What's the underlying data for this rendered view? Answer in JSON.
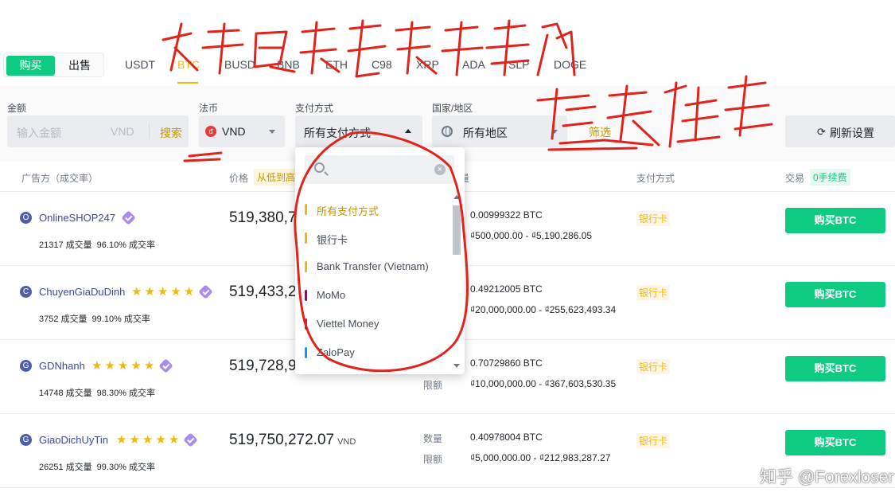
{
  "trade_toggle": {
    "buy": "购买",
    "sell": "出售"
  },
  "coins": [
    "USDT",
    "BTC",
    "BUSD",
    "BNB",
    "ETH",
    "C98",
    "XRP",
    "ADA",
    "SLP",
    "DOGE"
  ],
  "active_coin": "BTC",
  "filters": {
    "amount_label": "金额",
    "amount_placeholder": "输入金额",
    "amount_unit": "VND",
    "search_button": "搜索",
    "fiat_label": "法币",
    "fiat_value": "VND",
    "payment_label": "支付方式",
    "payment_value": "所有支付方式",
    "region_label": "国家/地区",
    "region_value": "所有地区",
    "filter_link": "筛选",
    "refresh_button": "刷新设置"
  },
  "table_header": {
    "advertiser": "广告方（成交率）",
    "price": "价格",
    "sort_badge": "从低到高",
    "quantity_tail": "量",
    "payment": "支付方式",
    "trade": "交易",
    "fee_badge": "0手续费"
  },
  "rows": [
    {
      "initial": "O",
      "merchant": "OnlineSHOP247",
      "stars": 0,
      "trades": "21317 成交量",
      "rate": "96.10% 成交率",
      "price": "519,380,7",
      "currency": "",
      "qty_label": "",
      "qty": "0.00999322 BTC",
      "limit_label": "",
      "limit": "₫500,000.00 - ₫5,190,286.05",
      "payment": "银行卡",
      "button": "购买BTC"
    },
    {
      "initial": "C",
      "merchant": "ChuyenGiaDuDinh",
      "stars": 5,
      "trades": "3752 成交量",
      "rate": "99.10% 成交率",
      "price": "519,433,2",
      "currency": "",
      "qty_label": "",
      "qty": "0.49212005 BTC",
      "limit_label": "",
      "limit": "₫20,000,000.00 - ₫255,623,493.34",
      "payment": "银行卡",
      "button": "购买BTC"
    },
    {
      "initial": "G",
      "merchant": "GDNhanh",
      "stars": 5,
      "trades": "14748 成交量",
      "rate": "98.30% 成交率",
      "price": "519,728,9",
      "currency": "",
      "qty_label": "",
      "qty": "0.70729860 BTC",
      "limit_label": "限额",
      "limit": "₫10,000,000.00 - ₫367,603,530.35",
      "payment": "银行卡",
      "button": "购买BTC"
    },
    {
      "initial": "G",
      "merchant": "GiaoDichUyTin",
      "stars": 5,
      "trades": "26251 成交量",
      "rate": "99.30% 成交率",
      "price": "519,750,272.07",
      "currency": "VND",
      "qty_label": "数量",
      "qty": "0.40978004 BTC",
      "limit_label": "限额",
      "limit": "₫5,000,000.00 - ₫212,983,287.27",
      "payment": "银行卡",
      "button": "购买BTC"
    }
  ],
  "dropdown": {
    "items": [
      {
        "label": "所有支付方式",
        "color": "#f0b90b",
        "selected": true
      },
      {
        "label": "银行卡",
        "color": "#f0b90b",
        "selected": false
      },
      {
        "label": "Bank Transfer (Vietnam)",
        "color": "#f0b90b",
        "selected": false
      },
      {
        "label": "MoMo",
        "color": "#a50064",
        "selected": false
      },
      {
        "label": "Viettel Money",
        "color": "#d6193e",
        "selected": false
      },
      {
        "label": "ZaloPay",
        "color": "#0e95f6",
        "selected": false
      }
    ]
  },
  "watermark": "知乎 @Forexloser",
  "colors": {
    "accent": "#f0b90b",
    "buy": "#0ecb81",
    "annotation": "#e0241b"
  }
}
